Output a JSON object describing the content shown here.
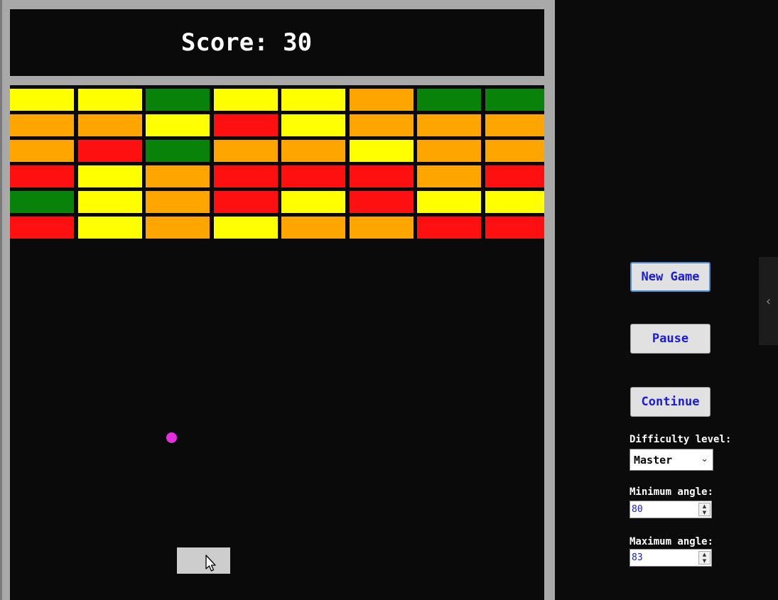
{
  "score_text": "Score: 30",
  "bricks": [
    [
      "#ffff00",
      "#ffff00",
      "#098209",
      "#ffff00",
      "#ffff00",
      "#ffa500",
      "#098209",
      "#098209"
    ],
    [
      "#ffa500",
      "#ffa500",
      "#ffff00",
      "#ff1010",
      "#ffff00",
      "#ffa500",
      "#ffa500",
      "#ffa500"
    ],
    [
      "#ffa500",
      "#ff1010",
      "#098209",
      "#ffa500",
      "#ffa500",
      "#ffff00",
      "#ffa500",
      "#ffa500"
    ],
    [
      "#ff1010",
      "#ffff00",
      "#ffa500",
      "#ff1010",
      "#ff1010",
      "#ff1010",
      "#ffa500",
      "#ff1010"
    ],
    [
      "#098209",
      "#ffff00",
      "#ffa500",
      "#ff1010",
      "#ffff00",
      "#ff1010",
      "#ffff00",
      "#ffff00"
    ],
    [
      "#ff1010",
      "#ffff00",
      "#ffa500",
      "#ffff00",
      "#ffa500",
      "#ffa500",
      "#ff1010",
      "#ff1010"
    ]
  ],
  "ball_color": "#e62ee0",
  "controls": {
    "new_game": "New Game",
    "pause": "Pause",
    "continue": "Continue",
    "difficulty_label": "Difficulty level:",
    "difficulty_value": "Master",
    "min_angle_label": "Minimum angle:",
    "min_angle_value": "80",
    "max_angle_label": "Maximum angle:",
    "max_angle_value": "83"
  },
  "icons": {
    "select_chevron": "chevron-down-icon",
    "collapse": "chevron-left-icon",
    "cursor": "mouse-pointer-icon"
  }
}
